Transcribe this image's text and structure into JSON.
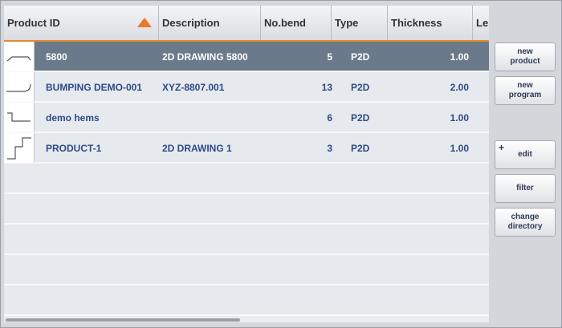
{
  "table": {
    "columns": [
      {
        "label": "Product ID"
      },
      {
        "label": "Description"
      },
      {
        "label": "No.bend"
      },
      {
        "label": "Type"
      },
      {
        "label": "Thickness"
      },
      {
        "label": "Le"
      }
    ],
    "rows": [
      {
        "product_id": "5800",
        "description": "2D DRAWING 5800",
        "no_bend": "5",
        "type": "P2D",
        "thickness": "1.00",
        "selected": true
      },
      {
        "product_id": "BUMPING DEMO-001",
        "description": "XYZ-8807.001",
        "no_bend": "13",
        "type": "P2D",
        "thickness": "2.00",
        "selected": false
      },
      {
        "product_id": "demo hems",
        "description": "",
        "no_bend": "6",
        "type": "P2D",
        "thickness": "1.00",
        "selected": false
      },
      {
        "product_id": "PRODUCT-1",
        "description": "2D DRAWING 1",
        "no_bend": "3",
        "type": "P2D",
        "thickness": "1.00",
        "selected": false
      }
    ],
    "sort_icon": "sort-ascending-icon",
    "accent_color": "#e8892e"
  },
  "sidebar": {
    "new_product": {
      "line1": "new",
      "line2": "product"
    },
    "new_program": {
      "line1": "new",
      "line2": "program"
    },
    "edit": {
      "label": "edit",
      "icon_glyph": "+"
    },
    "filter": {
      "label": "filter"
    },
    "change_directory": {
      "line1": "change",
      "line2": "directory"
    }
  }
}
